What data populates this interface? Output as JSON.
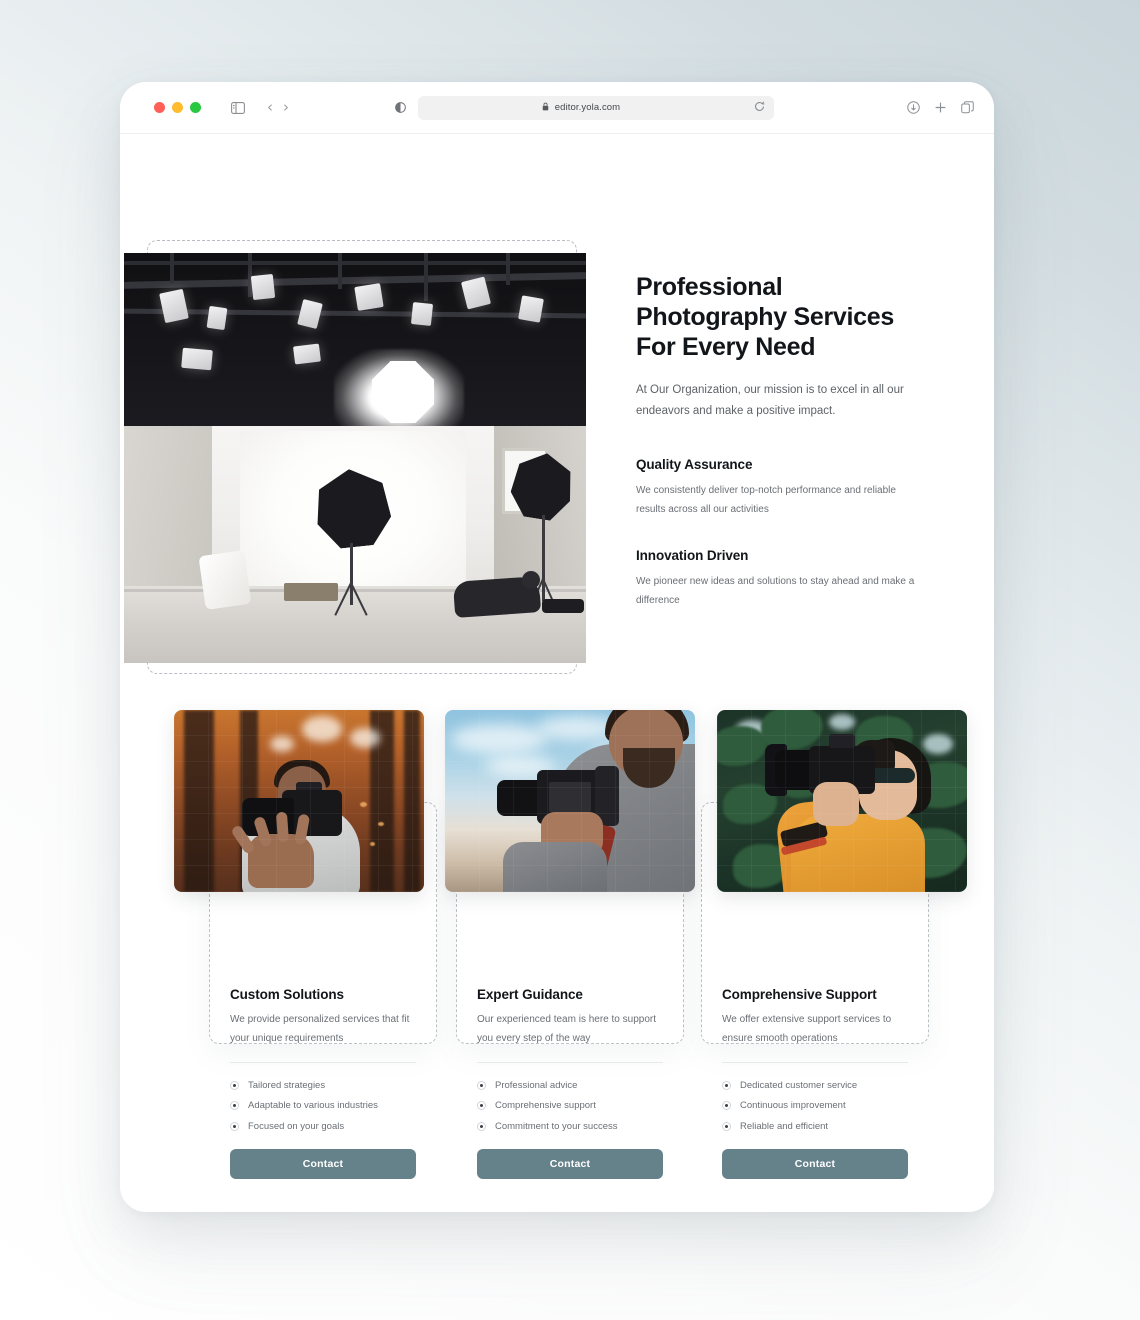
{
  "browser": {
    "url": "editor.yola.com",
    "lock_icon": "lock-icon",
    "reload_icon": "reload-icon",
    "sidebar_icon": "sidebar-toggle-icon",
    "back_arrow": "‹",
    "forward_arrow": "›",
    "shield_icon": "reader-contrast-icon",
    "download_icon": "download-icon",
    "new_tab_icon": "plus-icon",
    "tabs_icon": "tab-overview-icon"
  },
  "hero": {
    "title": "Professional Photography Services For Every Need",
    "subtitle": "At Our Organization, our mission is to excel in all our endeavors and make a positive impact.",
    "image_alt": "photography-studio-lighting-setup",
    "features": [
      {
        "title": "Quality Assurance",
        "text": "We consistently deliver top-notch performance and reliable results across all our activities"
      },
      {
        "title": "Innovation Driven",
        "text": "We pioneer new ideas and solutions to stay ahead and make a difference"
      }
    ]
  },
  "cards": [
    {
      "title": "Custom Solutions",
      "description": "We provide personalized services that fit your unique requirements",
      "image_alt": "photographer-tossing-camera-autumn-forest",
      "bullets": [
        "Tailored strategies",
        "Adaptable to various industries",
        "Focused on your goals"
      ],
      "button": "Contact"
    },
    {
      "title": "Expert Guidance",
      "description": "Our experienced team is here to support you every step of the way",
      "image_alt": "photographer-holding-camera-against-sky",
      "bullets": [
        "Professional advice",
        "Comprehensive support",
        "Commitment to your success"
      ],
      "button": "Contact"
    },
    {
      "title": "Comprehensive Support",
      "description": "We offer extensive support services to ensure smooth operations",
      "image_alt": "woman-photographer-shooting-in-greenery",
      "bullets": [
        "Dedicated customer service",
        "Continuous improvement",
        "Reliable and efficient"
      ],
      "button": "Contact"
    }
  ],
  "colors": {
    "accent_button": "#65818a",
    "heading": "#12161a",
    "body_text": "#6a6f75",
    "selection_dash": "#bcc1c6",
    "page_background_start": "#c9d5db",
    "page_background_end": "#ffffff"
  }
}
